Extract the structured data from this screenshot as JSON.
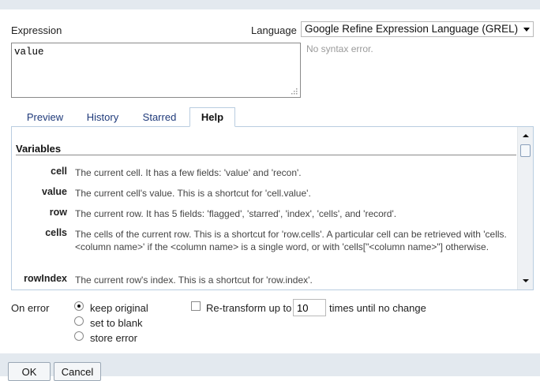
{
  "expression": {
    "label": "Expression",
    "value": "value",
    "syntax_status": "No syntax error."
  },
  "language": {
    "label": "Language",
    "selected": "Google Refine Expression Language (GREL)"
  },
  "tabs": [
    {
      "label": "Preview",
      "active": false
    },
    {
      "label": "History",
      "active": false
    },
    {
      "label": "Starred",
      "active": false
    },
    {
      "label": "Help",
      "active": true
    }
  ],
  "help": {
    "heading": "Variables",
    "variables": [
      {
        "name": "cell",
        "description": "The current cell. It has a few fields: 'value' and 'recon'."
      },
      {
        "name": "value",
        "description": "The current cell's value. This is a shortcut for 'cell.value'."
      },
      {
        "name": "row",
        "description": "The current row. It has 5 fields: 'flagged', 'starred', 'index', 'cells', and 'record'."
      },
      {
        "name": "cells",
        "description": "The cells of the current row. This is a shortcut for 'row.cells'. A particular cell can be retrieved with 'cells.<column name>' if the <column name> is a single word, or with 'cells[\"<column name>\"] otherwise."
      },
      {
        "name": "rowIndex",
        "description": "The current row's index. This is a shortcut for 'row.index'."
      }
    ]
  },
  "on_error": {
    "label": "On error",
    "options": [
      {
        "label": "keep original",
        "selected": true
      },
      {
        "label": "set to blank",
        "selected": false
      },
      {
        "label": "store error",
        "selected": false
      }
    ]
  },
  "retransform": {
    "label": "Re-transform up to",
    "times": "10",
    "suffix": "times until no change",
    "checked": false
  },
  "buttons": {
    "ok": "OK",
    "cancel": "Cancel"
  },
  "icons": {
    "resize_grip": "resize-grip-icon",
    "dropdown": "chevron-down-icon",
    "scroll_up": "scroll-up-icon",
    "scroll_down": "scroll-down-icon"
  },
  "colors": {
    "tab_text": "#1f3a7a",
    "panel_border": "#b9cde0",
    "footer_bg": "#e3e9ef"
  }
}
